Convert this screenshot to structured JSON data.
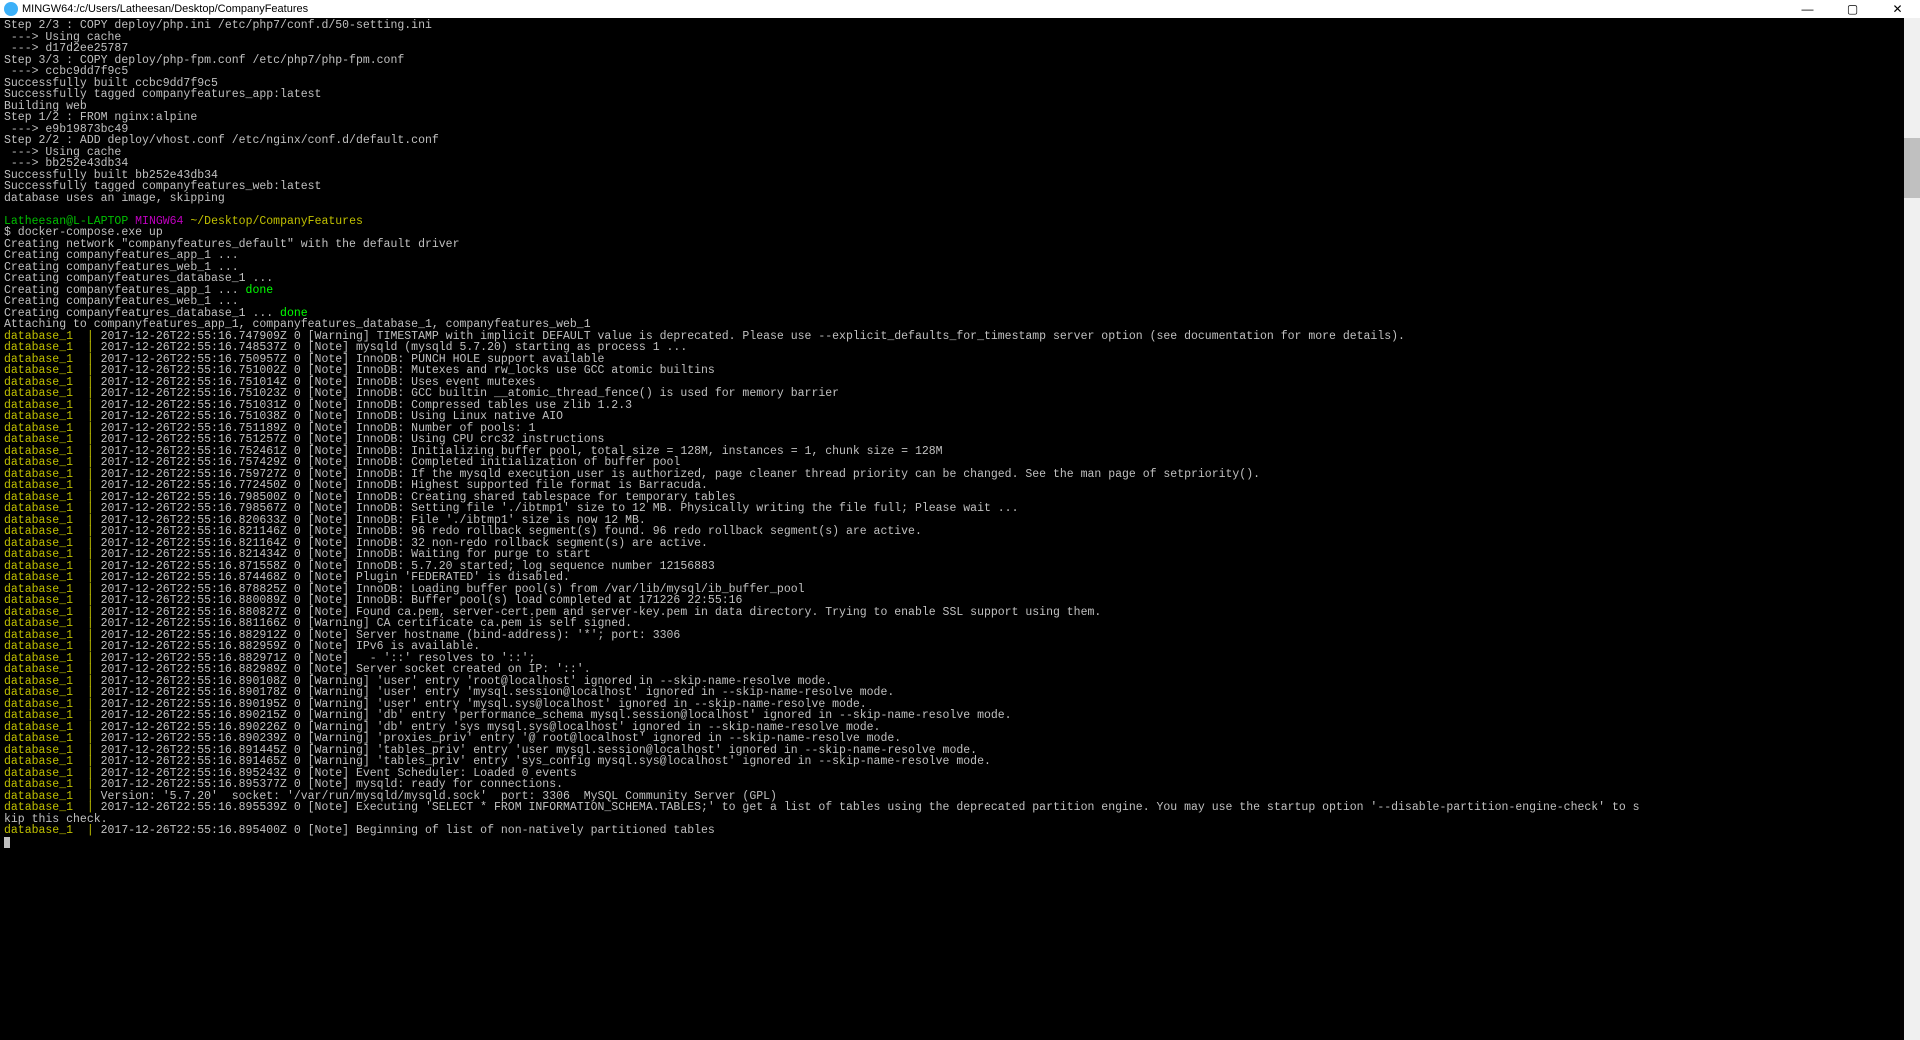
{
  "window": {
    "title": "MINGW64:/c/Users/Latheesan/Desktop/CompanyFeatures"
  },
  "prompt": {
    "user": "Latheesan@L-LAPTOP",
    "shell": "MINGW64",
    "path": "~/Desktop/CompanyFeatures",
    "command": "docker-compose.exe up"
  },
  "build": [
    "Step 2/3 : COPY deploy/php.ini /etc/php7/conf.d/50-setting.ini",
    " ---> Using cache",
    " ---> d17d2ee25787",
    "Step 3/3 : COPY deploy/php-fpm.conf /etc/php7/php-fpm.conf",
    " ---> ccbc9dd7f9c5",
    "Successfully built ccbc9dd7f9c5",
    "Successfully tagged companyfeatures_app:latest",
    "Building web",
    "Step 1/2 : FROM nginx:alpine",
    " ---> e9b19873bc49",
    "Step 2/2 : ADD deploy/vhost.conf /etc/nginx/conf.d/default.conf",
    " ---> Using cache",
    " ---> bb252e43db34",
    "Successfully built bb252e43db34",
    "Successfully tagged companyfeatures_web:latest",
    "database uses an image, skipping"
  ],
  "creating": [
    {
      "text": "Creating network \"companyfeatures_default\" with the default driver"
    },
    {
      "text": "Creating companyfeatures_app_1 ..."
    },
    {
      "text": "Creating companyfeatures_web_1 ..."
    },
    {
      "text": "Creating companyfeatures_database_1 ..."
    },
    {
      "text": "Creating companyfeatures_app_1 ... ",
      "done": "done"
    },
    {
      "text": "Creating companyfeatures_web_1 ..."
    },
    {
      "text": "Creating companyfeatures_database_1 ... ",
      "done": "done"
    },
    {
      "text": "Attaching to companyfeatures_app_1, companyfeatures_database_1, companyfeatures_web_1"
    }
  ],
  "dblines": [
    {
      "t": "2017-12-26T22:55:16.747909Z 0 [Warning] TIMESTAMP with implicit DEFAULT value is deprecated. Please use --explicit_defaults_for_timestamp server option (see documentation for more details)."
    },
    {
      "t": "2017-12-26T22:55:16.748537Z 0 [Note] mysqld (mysqld 5.7.20) starting as process 1 ..."
    },
    {
      "t": "2017-12-26T22:55:16.750957Z 0 [Note] InnoDB: PUNCH HOLE support available"
    },
    {
      "t": "2017-12-26T22:55:16.751002Z 0 [Note] InnoDB: Mutexes and rw_locks use GCC atomic builtins"
    },
    {
      "t": "2017-12-26T22:55:16.751014Z 0 [Note] InnoDB: Uses event mutexes"
    },
    {
      "t": "2017-12-26T22:55:16.751023Z 0 [Note] InnoDB: GCC builtin __atomic_thread_fence() is used for memory barrier"
    },
    {
      "t": "2017-12-26T22:55:16.751031Z 0 [Note] InnoDB: Compressed tables use zlib 1.2.3"
    },
    {
      "t": "2017-12-26T22:55:16.751038Z 0 [Note] InnoDB: Using Linux native AIO"
    },
    {
      "t": "2017-12-26T22:55:16.751189Z 0 [Note] InnoDB: Number of pools: 1"
    },
    {
      "t": "2017-12-26T22:55:16.751257Z 0 [Note] InnoDB: Using CPU crc32 instructions"
    },
    {
      "t": "2017-12-26T22:55:16.752461Z 0 [Note] InnoDB: Initializing buffer pool, total size = 128M, instances = 1, chunk size = 128M"
    },
    {
      "t": "2017-12-26T22:55:16.757429Z 0 [Note] InnoDB: Completed initialization of buffer pool"
    },
    {
      "t": "2017-12-26T22:55:16.759727Z 0 [Note] InnoDB: If the mysqld execution user is authorized, page cleaner thread priority can be changed. See the man page of setpriority()."
    },
    {
      "t": "2017-12-26T22:55:16.772450Z 0 [Note] InnoDB: Highest supported file format is Barracuda."
    },
    {
      "t": "2017-12-26T22:55:16.798500Z 0 [Note] InnoDB: Creating shared tablespace for temporary tables"
    },
    {
      "t": "2017-12-26T22:55:16.798567Z 0 [Note] InnoDB: Setting file './ibtmp1' size to 12 MB. Physically writing the file full; Please wait ..."
    },
    {
      "t": "2017-12-26T22:55:16.820633Z 0 [Note] InnoDB: File './ibtmp1' size is now 12 MB."
    },
    {
      "t": "2017-12-26T22:55:16.821146Z 0 [Note] InnoDB: 96 redo rollback segment(s) found. 96 redo rollback segment(s) are active."
    },
    {
      "t": "2017-12-26T22:55:16.821164Z 0 [Note] InnoDB: 32 non-redo rollback segment(s) are active."
    },
    {
      "t": "2017-12-26T22:55:16.821434Z 0 [Note] InnoDB: Waiting for purge to start"
    },
    {
      "t": "2017-12-26T22:55:16.871558Z 0 [Note] InnoDB: 5.7.20 started; log sequence number 12156883"
    },
    {
      "t": "2017-12-26T22:55:16.874468Z 0 [Note] Plugin 'FEDERATED' is disabled."
    },
    {
      "t": "2017-12-26T22:55:16.878825Z 0 [Note] InnoDB: Loading buffer pool(s) from /var/lib/mysql/ib_buffer_pool"
    },
    {
      "t": "2017-12-26T22:55:16.880089Z 0 [Note] InnoDB: Buffer pool(s) load completed at 171226 22:55:16"
    },
    {
      "t": "2017-12-26T22:55:16.880827Z 0 [Note] Found ca.pem, server-cert.pem and server-key.pem in data directory. Trying to enable SSL support using them."
    },
    {
      "t": "2017-12-26T22:55:16.881166Z 0 [Warning] CA certificate ca.pem is self signed."
    },
    {
      "t": "2017-12-26T22:55:16.882912Z 0 [Note] Server hostname (bind-address): '*'; port: 3306"
    },
    {
      "t": "2017-12-26T22:55:16.882959Z 0 [Note] IPv6 is available."
    },
    {
      "t": "2017-12-26T22:55:16.882971Z 0 [Note]   - '::' resolves to '::';"
    },
    {
      "t": "2017-12-26T22:55:16.882989Z 0 [Note] Server socket created on IP: '::'."
    },
    {
      "t": "2017-12-26T22:55:16.890108Z 0 [Warning] 'user' entry 'root@localhost' ignored in --skip-name-resolve mode."
    },
    {
      "t": "2017-12-26T22:55:16.890178Z 0 [Warning] 'user' entry 'mysql.session@localhost' ignored in --skip-name-resolve mode."
    },
    {
      "t": "2017-12-26T22:55:16.890195Z 0 [Warning] 'user' entry 'mysql.sys@localhost' ignored in --skip-name-resolve mode."
    },
    {
      "t": "2017-12-26T22:55:16.890215Z 0 [Warning] 'db' entry 'performance_schema mysql.session@localhost' ignored in --skip-name-resolve mode."
    },
    {
      "t": "2017-12-26T22:55:16.890226Z 0 [Warning] 'db' entry 'sys mysql.sys@localhost' ignored in --skip-name-resolve mode."
    },
    {
      "t": "2017-12-26T22:55:16.890239Z 0 [Warning] 'proxies_priv' entry '@ root@localhost' ignored in --skip-name-resolve mode."
    },
    {
      "t": "2017-12-26T22:55:16.891445Z 0 [Warning] 'tables_priv' entry 'user mysql.session@localhost' ignored in --skip-name-resolve mode."
    },
    {
      "t": "2017-12-26T22:55:16.891465Z 0 [Warning] 'tables_priv' entry 'sys_config mysql.sys@localhost' ignored in --skip-name-resolve mode."
    },
    {
      "t": "2017-12-26T22:55:16.895243Z 0 [Note] Event Scheduler: Loaded 0 events"
    },
    {
      "t": "2017-12-26T22:55:16.895377Z 0 [Note] mysqld: ready for connections."
    },
    {
      "t": "Version: '5.7.20'  socket: '/var/run/mysqld/mysqld.sock'  port: 3306  MySQL Community Server (GPL)"
    },
    {
      "t": "2017-12-26T22:55:16.895539Z 0 [Note] Executing 'SELECT * FROM INFORMATION_SCHEMA.TABLES;' to get a list of tables using the deprecated partition engine. You may use the startup option '--disable-partition-engine-check' to s",
      "wrap": true
    }
  ],
  "wraptail": "kip this check.",
  "dblast": {
    "t": "2017-12-26T22:55:16.895400Z 0 [Note] Beginning of list of non-natively partitioned tables"
  },
  "prefix": "database_1  |"
}
